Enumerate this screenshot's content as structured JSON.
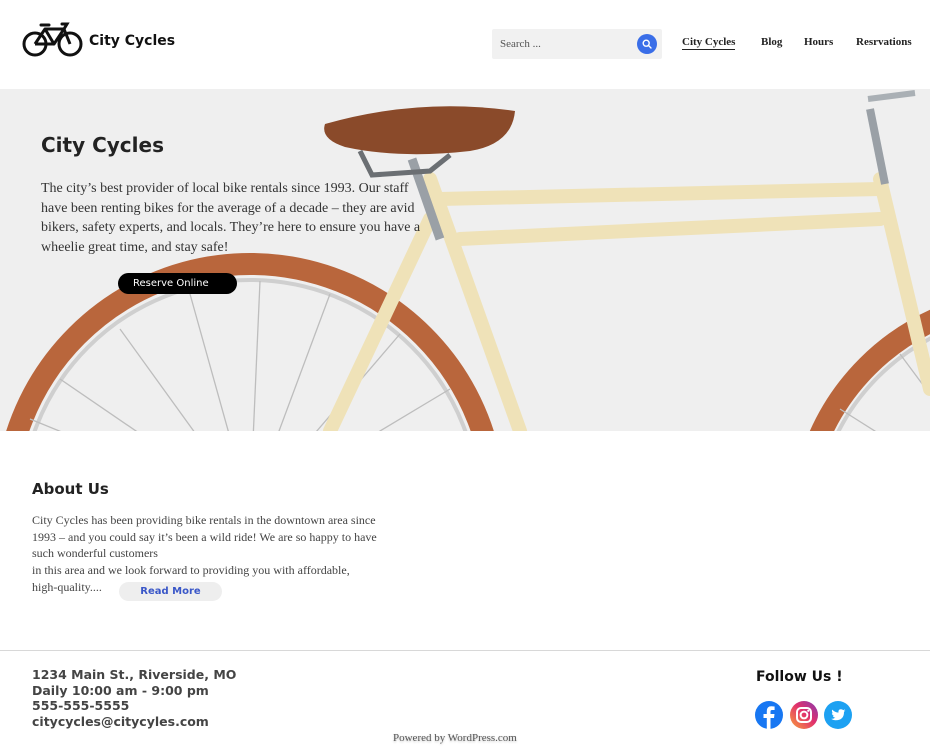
{
  "header": {
    "site_title": "City Cycles",
    "search_placeholder": "Search ...",
    "nav": [
      "City Cycles",
      "Blog",
      "Hours",
      "Resrvations"
    ]
  },
  "hero": {
    "title": "City Cycles",
    "text": "The city’s best provider of local bike rentals since 1993. Our staff have been renting bikes for the average of a decade – they are avid bikers, safety experts, and locals. They’re here to ensure you have a wheelie great time, and stay safe!",
    "button": "Reserve Online"
  },
  "about": {
    "title": "About Us",
    "text_lines": [
      "City Cycles has been providing bike rentals in the downtown area since",
      "1993 – and you  could say it’s been a wild ride! We are so happy to have",
      "such wonderful customers",
      "in this area and we look forward to providing you with affordable,",
      "high-quality...."
    ],
    "read_more": "Read More"
  },
  "footer": {
    "contact": [
      "1234 Main St., Riverside, MO",
      "Daily 10:00 am - 9:00 pm",
      "555-555-5555",
      "citycycles@citycyles.com"
    ],
    "follow_title": "Follow Us !",
    "social": [
      "facebook-icon",
      "instagram-icon",
      "twitter-icon"
    ],
    "powered": "Powered by WordPress.com"
  },
  "colors": {
    "accent_blue": "#3a6ee8",
    "facebook": "#1877f2",
    "twitter": "#1da1f2",
    "frame": "#efe2b8",
    "tire": "#b9663c"
  }
}
